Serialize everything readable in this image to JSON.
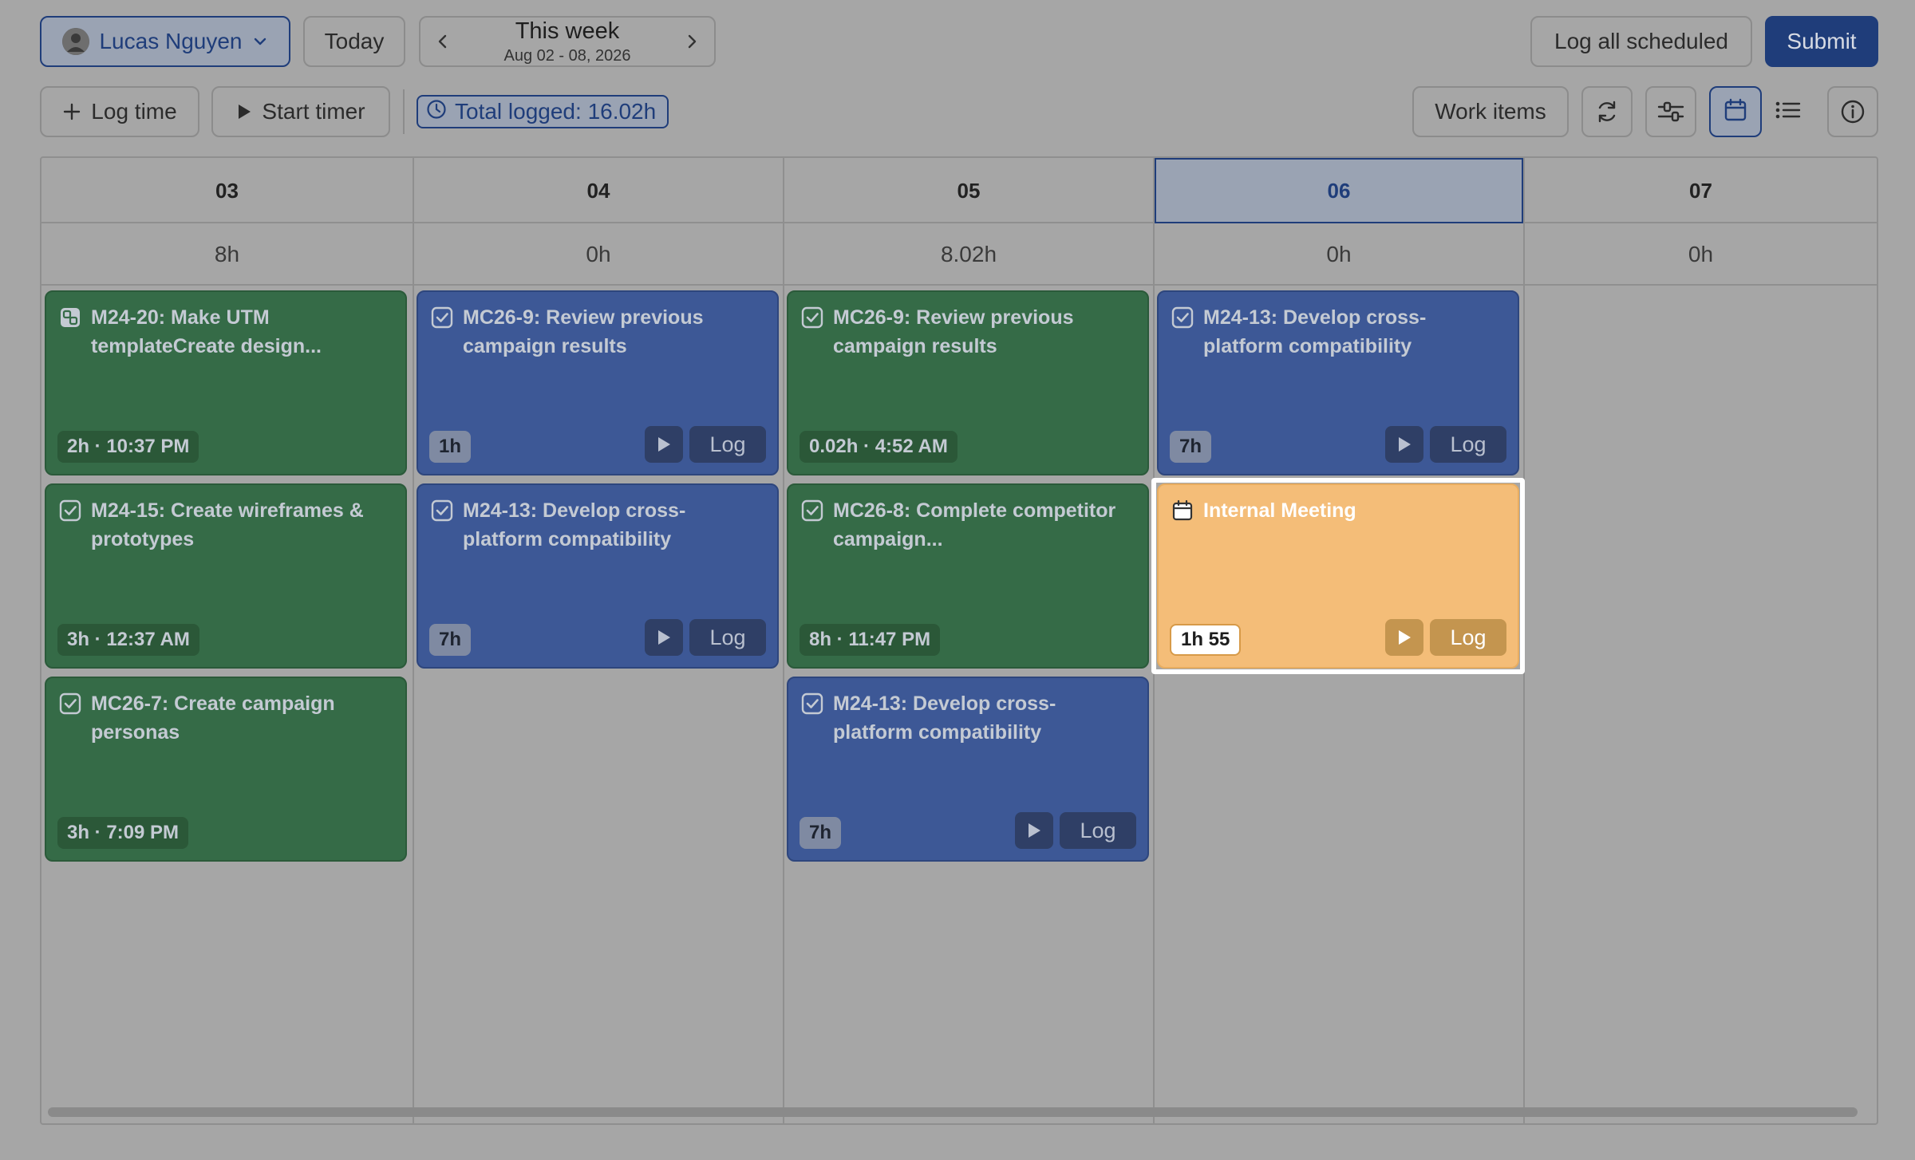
{
  "header": {
    "user_name": "Lucas Nguyen",
    "today_label": "Today",
    "week_title": "This week",
    "week_range": "Aug 02 - 08, 2026",
    "log_all_label": "Log all scheduled",
    "submit_label": "Submit"
  },
  "toolbar": {
    "log_time_label": "Log time",
    "start_timer_label": "Start timer",
    "total_logged": "Total logged: 16.02h",
    "work_items_label": "Work items"
  },
  "colors": {
    "accent": "#1f3d7a",
    "work_item_green": "#356b47",
    "work_item_blue": "#3d5896",
    "meeting_orange": "#f4bd78"
  },
  "days": [
    {
      "label": "03",
      "total": "8h",
      "is_today": false
    },
    {
      "label": "04",
      "total": "0h",
      "is_today": false
    },
    {
      "label": "05",
      "total": "8.02h",
      "is_today": false
    },
    {
      "label": "06",
      "total": "0h",
      "is_today": true
    },
    {
      "label": "07",
      "total": "0h",
      "is_today": false
    }
  ],
  "entries": {
    "d03": [
      {
        "title": "M24-20: Make UTM templateCreate design...",
        "meta": "2h · 10:37 PM",
        "icon": "subtask-icon"
      },
      {
        "title": "M24-15: Create wireframes & prototypes",
        "meta": "3h · 12:37 AM",
        "icon": "checkbox-icon"
      },
      {
        "title": "MC26-7: Create campaign personas",
        "meta": "3h · 7:09 PM",
        "icon": "checkbox-icon"
      }
    ],
    "d04": [
      {
        "title": "MC26-9: Review previous campaign results",
        "meta": "1h",
        "log_label": "Log",
        "icon": "checkbox-icon"
      },
      {
        "title": "M24-13: Develop cross-platform compatibility",
        "meta": "7h",
        "log_label": "Log",
        "icon": "checkbox-icon"
      }
    ],
    "d05": [
      {
        "title": "MC26-9: Review previous campaign results",
        "meta": "0.02h · 4:52 AM",
        "icon": "checkbox-icon"
      },
      {
        "title": "MC26-8: Complete competitor campaign...",
        "meta": "8h · 11:47 PM",
        "icon": "checkbox-icon"
      },
      {
        "title": "M24-13: Develop cross-platform compatibility",
        "meta": "7h",
        "log_label": "Log",
        "icon": "checkbox-icon"
      }
    ],
    "d06": [
      {
        "title": "M24-13: Develop cross-platform compatibility",
        "meta": "7h",
        "log_label": "Log",
        "icon": "checkbox-icon"
      },
      {
        "title": "Internal Meeting",
        "meta": "1h 55",
        "log_label": "Log",
        "icon": "calendar-icon"
      }
    ]
  }
}
